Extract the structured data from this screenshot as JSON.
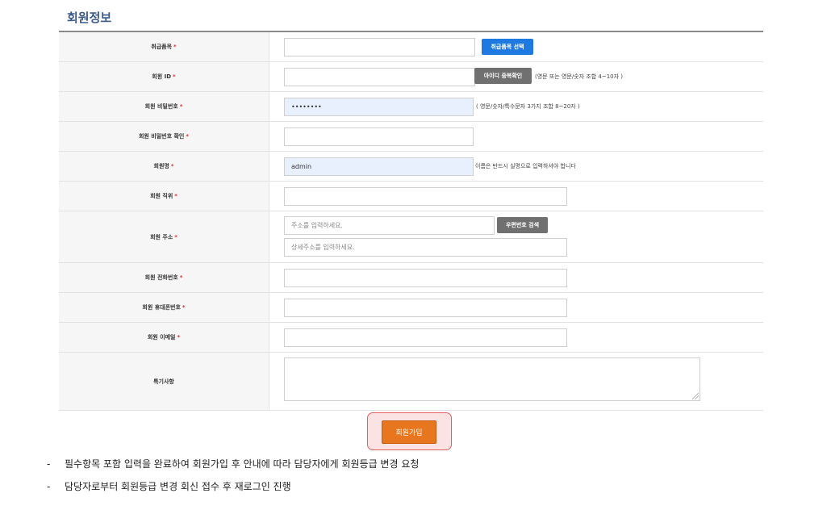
{
  "section_title": "회원정보",
  "fields": {
    "category": {
      "label": "취급품목",
      "required": "*",
      "value": "",
      "button": "취급품목 선택"
    },
    "member_id": {
      "label": "회원 ID",
      "required": "*",
      "value": "",
      "button": "아이디 중복확인",
      "hint": "(영문 또는 영문/숫자 조합 4~10자 )"
    },
    "password": {
      "label": "회원 비밀번호",
      "required": "*",
      "value": "••••••••",
      "hint": "( 영문/숫자/특수문자 3가지 조합 8~20자 )"
    },
    "password_confirm": {
      "label": "회원 비밀번호 확인",
      "required": "*",
      "value": ""
    },
    "name": {
      "label": "회원명",
      "required": "*",
      "value": "admin",
      "hint": "이름은 반드시 실명으로 입력하셔야 합니다"
    },
    "position": {
      "label": "회원 직위",
      "required": "*",
      "value": ""
    },
    "address": {
      "label": "회원 주소",
      "required": "*",
      "placeholder": "주소를 입력하세요.",
      "detail_placeholder": "상세주소를 입력하세요.",
      "button": "우편번호 검색"
    },
    "phone": {
      "label": "회원 전화번호",
      "required": "*",
      "value": ""
    },
    "mobile": {
      "label": "회원 휴대폰번호",
      "required": "*",
      "value": ""
    },
    "email": {
      "label": "회원 이메일",
      "required": "*",
      "value": ""
    },
    "notes": {
      "label": "특기사항",
      "value": ""
    }
  },
  "submit_label": "회원가입",
  "notes": [
    {
      "dash": "-",
      "text": "필수항목 포함 입력을 완료하여 회원가입 후 안내에 따라 담당자에게 회원등급 변경 요청"
    },
    {
      "dash": "-",
      "text": "담당자로부터 회원등급 변경 회신 접수 후 재로그인 진행"
    }
  ],
  "colors": {
    "accent_blue": "#1e7ae0",
    "submit_orange": "#e8761f",
    "required_red": "#e03030",
    "title_blue": "#3b5a8a"
  }
}
